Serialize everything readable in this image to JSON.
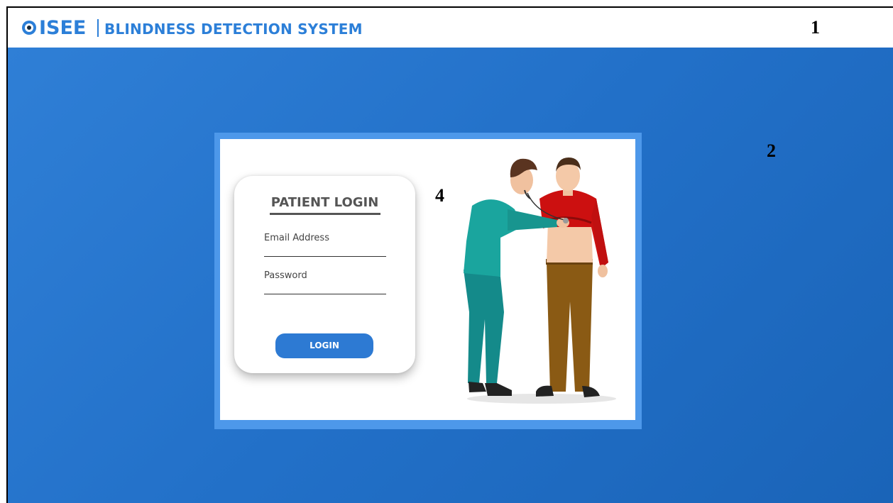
{
  "header": {
    "logo_text": "ISEE",
    "app_title": "BLINDNESS DETECTION SYSTEM"
  },
  "annotations": {
    "one": "1",
    "two": "2",
    "four": "4"
  },
  "login": {
    "title": "PATIENT LOGIN",
    "email_label": "Email Address",
    "password_label": "Password",
    "button_label": "LOGIN"
  },
  "colors": {
    "brand": "#2c7fd8",
    "background": "#2270c8",
    "button": "#2d7ad3"
  },
  "icons": {
    "logo": "eye-icon",
    "illustration": "doctor-patient-illustration"
  }
}
